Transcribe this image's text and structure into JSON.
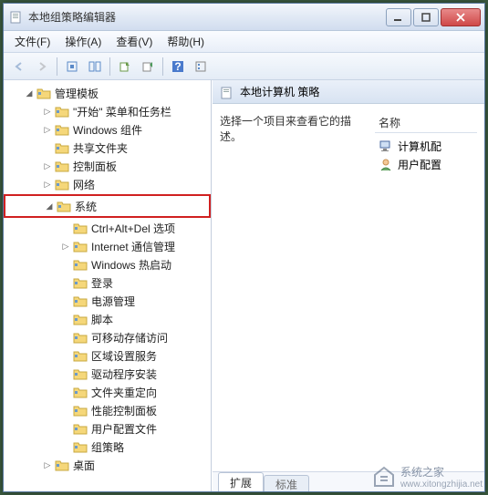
{
  "window": {
    "title": "本地组策略编辑器"
  },
  "menu": {
    "file": "文件(F)",
    "action": "操作(A)",
    "view": "查看(V)",
    "help": "帮助(H)"
  },
  "tree": {
    "root": "管理模板",
    "items": [
      {
        "label": "\"开始\" 菜单和任务栏",
        "exp": "closed"
      },
      {
        "label": "Windows 组件",
        "exp": "closed"
      },
      {
        "label": "共享文件夹",
        "exp": "none"
      },
      {
        "label": "控制面板",
        "exp": "closed"
      },
      {
        "label": "网络",
        "exp": "closed"
      }
    ],
    "system": {
      "label": "系统",
      "exp": "open"
    },
    "system_children": [
      {
        "label": "Ctrl+Alt+Del 选项",
        "exp": "none"
      },
      {
        "label": "Internet 通信管理",
        "exp": "closed"
      },
      {
        "label": "Windows 热启动",
        "exp": "none"
      },
      {
        "label": "登录",
        "exp": "none"
      },
      {
        "label": "电源管理",
        "exp": "none"
      },
      {
        "label": "脚本",
        "exp": "none"
      },
      {
        "label": "可移动存储访问",
        "exp": "none"
      },
      {
        "label": "区域设置服务",
        "exp": "none"
      },
      {
        "label": "驱动程序安装",
        "exp": "none"
      },
      {
        "label": "文件夹重定向",
        "exp": "none"
      },
      {
        "label": "性能控制面板",
        "exp": "none"
      },
      {
        "label": "用户配置文件",
        "exp": "none"
      },
      {
        "label": "组策略",
        "exp": "none"
      }
    ],
    "after_system": {
      "label": "桌面",
      "exp": "closed"
    }
  },
  "right": {
    "header": "本地计算机 策略",
    "description": "选择一个项目来查看它的描述。",
    "col_name": "名称",
    "items": {
      "computer": "计算机配",
      "user": "用户配置"
    }
  },
  "tabs": {
    "extended": "扩展",
    "standard": "标准"
  },
  "watermark": {
    "brand": "系统之家",
    "url": "www.xitongzhijia.net"
  }
}
